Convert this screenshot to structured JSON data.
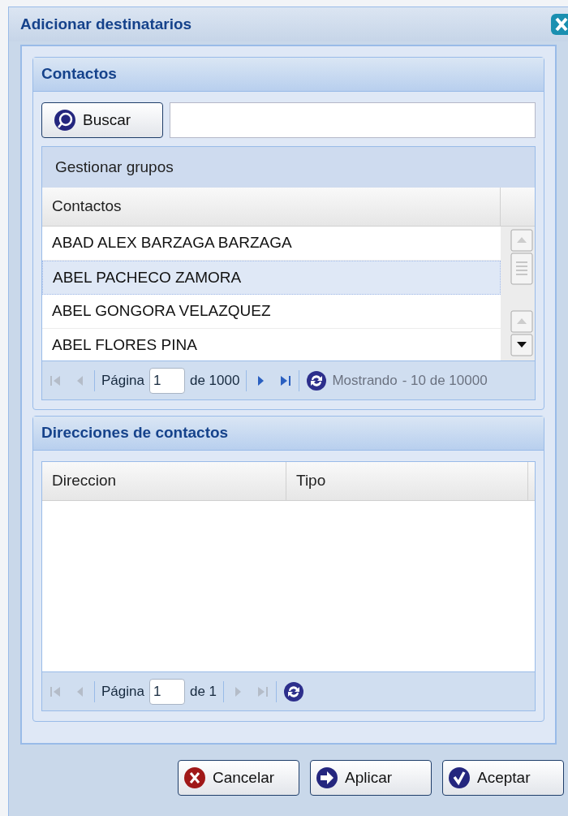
{
  "window": {
    "title": "Adicionar destinatarios"
  },
  "contacts_panel": {
    "title": "Contactos",
    "search_button": "Buscar",
    "groups_bar": "Gestionar grupos",
    "columns": [
      "Contactos"
    ],
    "rows": [
      {
        "name": "ABAD ALEX BARZAGA BARZAGA",
        "selected": false
      },
      {
        "name": "ABEL PACHECO ZAMORA",
        "selected": true
      },
      {
        "name": "ABEL GONGORA VELAZQUEZ",
        "selected": false
      },
      {
        "name": "ABEL FLORES PINA",
        "selected": false
      }
    ],
    "pager": {
      "page_label": "Página",
      "page": "1",
      "of": "de 1000",
      "nav": [
        {
          "kind": "first",
          "disabled": true
        },
        {
          "kind": "prev",
          "disabled": true
        },
        {
          "kind": "next",
          "disabled": false
        },
        {
          "kind": "last",
          "disabled": false
        }
      ],
      "status": [
        "Mostrando",
        "- 10 de 10000"
      ]
    }
  },
  "addresses_panel": {
    "title": "Direcciones de contactos",
    "columns": [
      "Direccion",
      "Tipo"
    ],
    "pager": {
      "page_label": "Página",
      "page": "1",
      "of": "de 1",
      "nav": [
        {
          "kind": "first",
          "disabled": true
        },
        {
          "kind": "prev",
          "disabled": true
        },
        {
          "kind": "next",
          "disabled": true
        },
        {
          "kind": "last",
          "disabled": true
        }
      ]
    }
  },
  "buttons": [
    {
      "kind": "cancel",
      "label": "Cancelar"
    },
    {
      "kind": "apply",
      "label": "Aplicar"
    },
    {
      "kind": "accept",
      "label": "Aceptar"
    }
  ]
}
